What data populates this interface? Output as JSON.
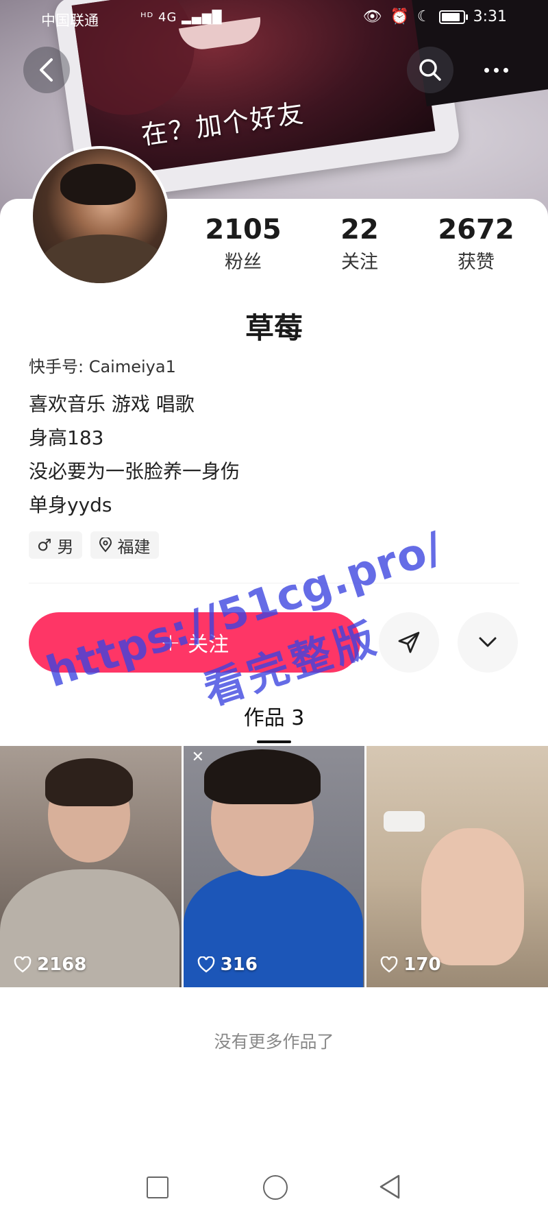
{
  "status_bar": {
    "carrier": "中国联通",
    "network": "4G",
    "time": "3:31"
  },
  "cover": {
    "caption": "在？加个好友"
  },
  "profile": {
    "name": "草莓",
    "kuaishou_id": "快手号: Caimeiya1",
    "stats": [
      {
        "value": "2105",
        "label": "粉丝"
      },
      {
        "value": "22",
        "label": "关注"
      },
      {
        "value": "2672",
        "label": "获赞"
      }
    ],
    "bio": [
      "喜欢音乐 游戏 唱歌",
      "身高183",
      "没必要为一张脸养一身伤",
      "单身yyds"
    ],
    "tags": [
      {
        "icon": "male-icon",
        "symbol": "♂",
        "label": "男"
      },
      {
        "icon": "location-icon",
        "symbol": "",
        "label": "福建"
      }
    ]
  },
  "actions": {
    "follow_label": "关注",
    "follow_plus": "+"
  },
  "works": {
    "tab_label": "作品 3",
    "items": [
      {
        "likes": "2168"
      },
      {
        "likes": "316"
      },
      {
        "likes": "170"
      }
    ],
    "end_text": "没有更多作品了"
  },
  "watermark": {
    "url": "https://51cg.pro/",
    "text": "看完整版"
  },
  "colors": {
    "accent": "#fe3666",
    "watermark": "#3b43e0"
  }
}
